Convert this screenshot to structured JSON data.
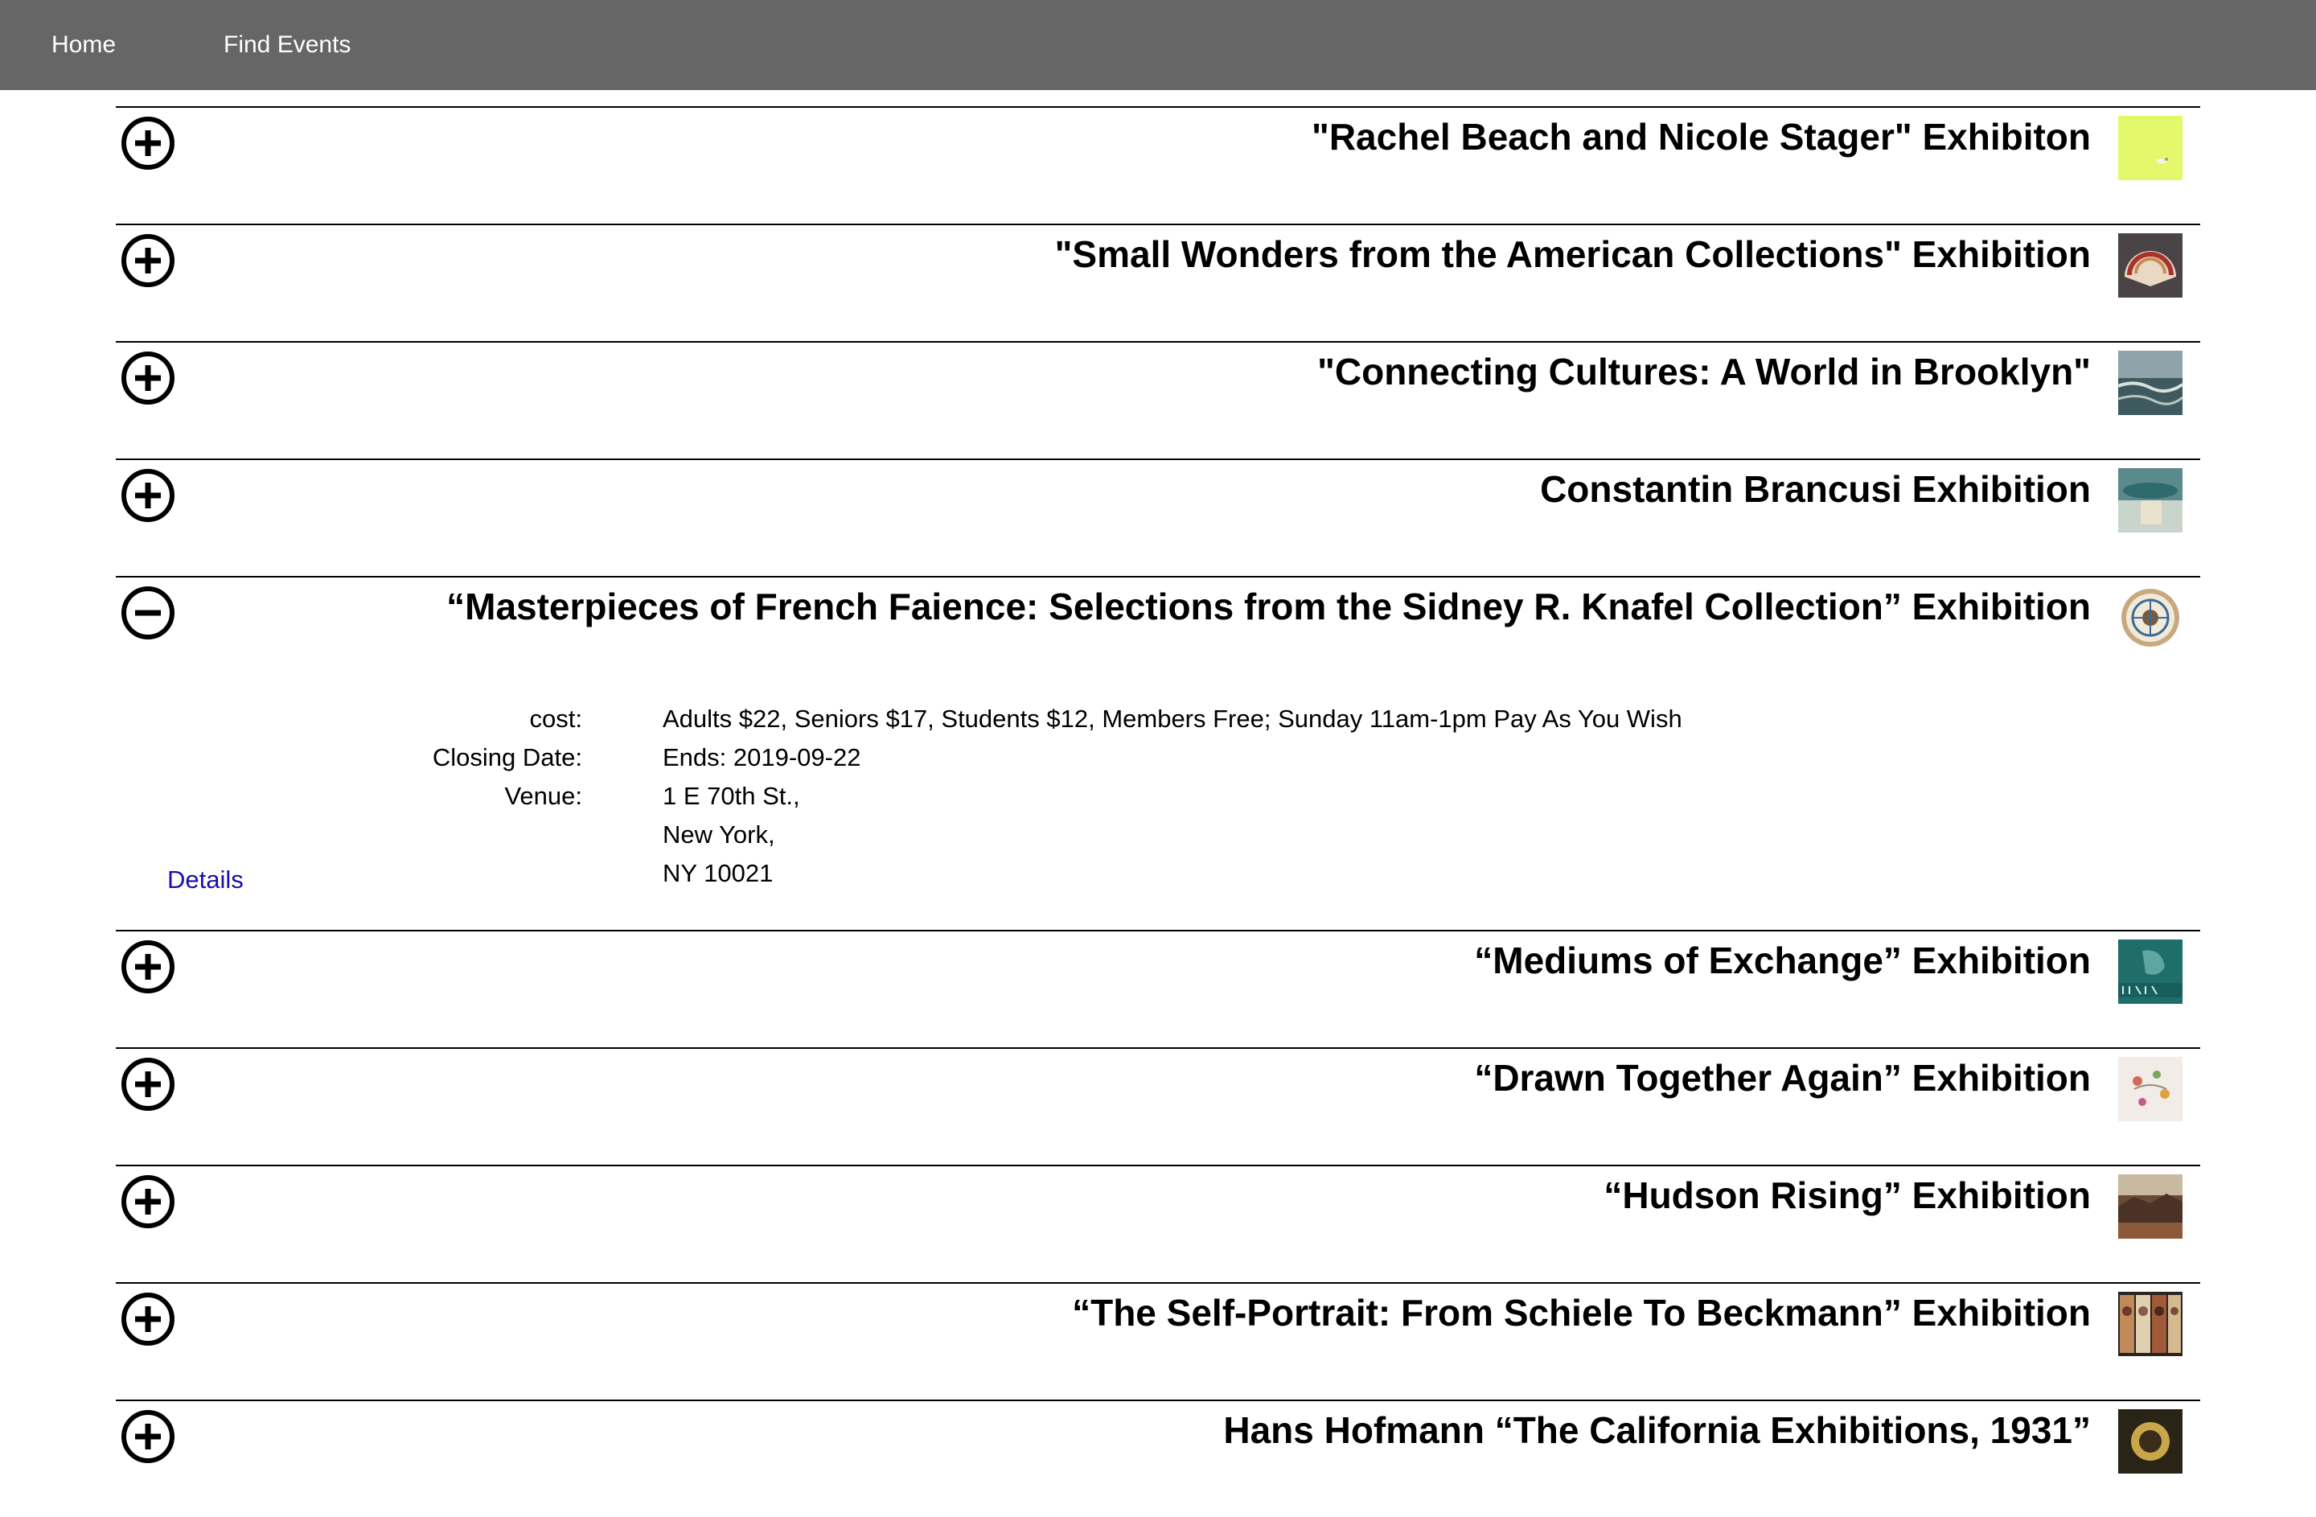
{
  "nav": {
    "home": "Home",
    "find_events": "Find Events"
  },
  "events": [
    {
      "title": "\"Rachel Beach and Nicole Stager\" Exhibiton",
      "expanded": false
    },
    {
      "title": "\"Small Wonders from the American Collections\" Exhibition",
      "expanded": false
    },
    {
      "title": "\"Connecting Cultures: A World in Brooklyn\"",
      "expanded": false
    },
    {
      "title": "Constantin Brancusi Exhibition",
      "expanded": false
    },
    {
      "title": "“Masterpieces of French Faience: Selections from the Sidney R. Knafel Collection” Exhibition",
      "expanded": true,
      "cost_label": "cost:",
      "cost": "Adults $22, Seniors $17, Students $12, Members Free; Sunday 11am-1pm Pay As You Wish",
      "closing_label": "Closing Date:",
      "closing": "Ends: 2019-09-22",
      "venue_label": "Venue:",
      "venue_line1": "1 E 70th St.,",
      "venue_line2": "New York,",
      "venue_line3": "NY 10021",
      "details_link": "Details"
    },
    {
      "title": "“Mediums of Exchange” Exhibition",
      "expanded": false
    },
    {
      "title": "“Drawn Together Again” Exhibition",
      "expanded": false
    },
    {
      "title": "“Hudson Rising” Exhibition",
      "expanded": false
    },
    {
      "title": "“The Self-Portrait: From Schiele To Beckmann” Exhibition",
      "expanded": false
    },
    {
      "title": "Hans Hofmann “The California Exhibitions, 1931”",
      "expanded": false
    }
  ]
}
